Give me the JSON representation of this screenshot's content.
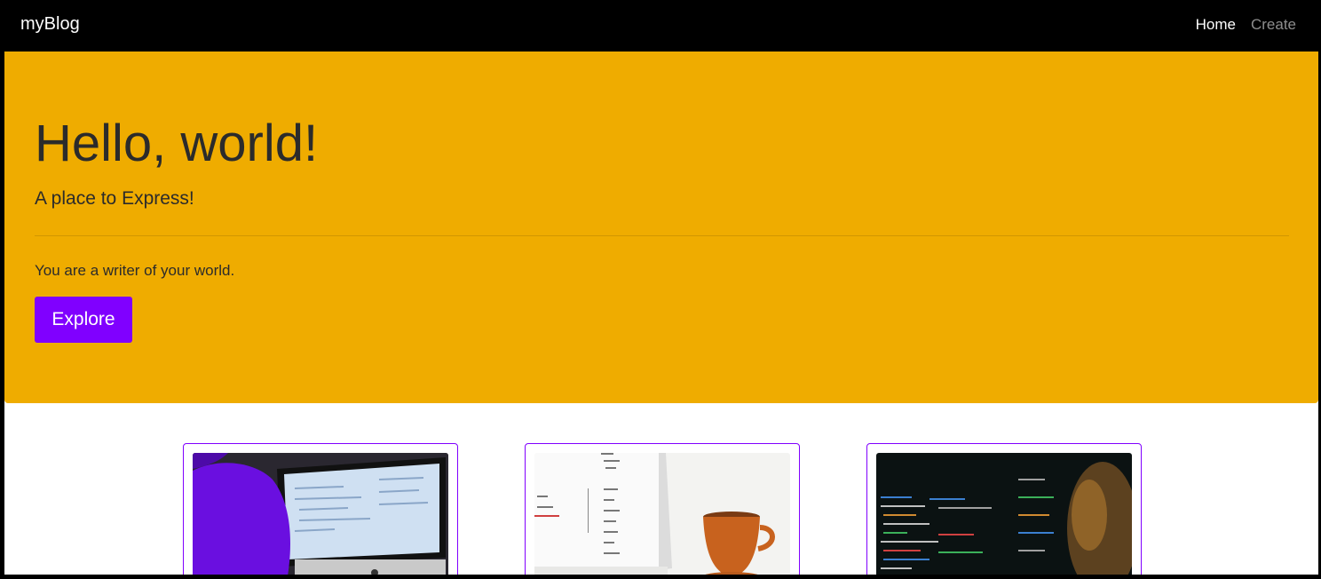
{
  "navbar": {
    "brand": "myBlog",
    "links": [
      {
        "label": "Home",
        "active": true
      },
      {
        "label": "Create",
        "active": false
      }
    ]
  },
  "jumbotron": {
    "title": "Hello, world!",
    "lead": "A place to Express!",
    "text": "You are a writer of your world.",
    "button_label": "Explore"
  },
  "cards": [
    {
      "image": "person-at-imac-coding-photo"
    },
    {
      "image": "code-screen-with-coffee-cup-photo"
    },
    {
      "image": "dark-code-screen-photo"
    }
  ],
  "colors": {
    "jumbotron_bg": "#efac00",
    "accent": "#8000ff",
    "navbar_bg": "#000000"
  }
}
